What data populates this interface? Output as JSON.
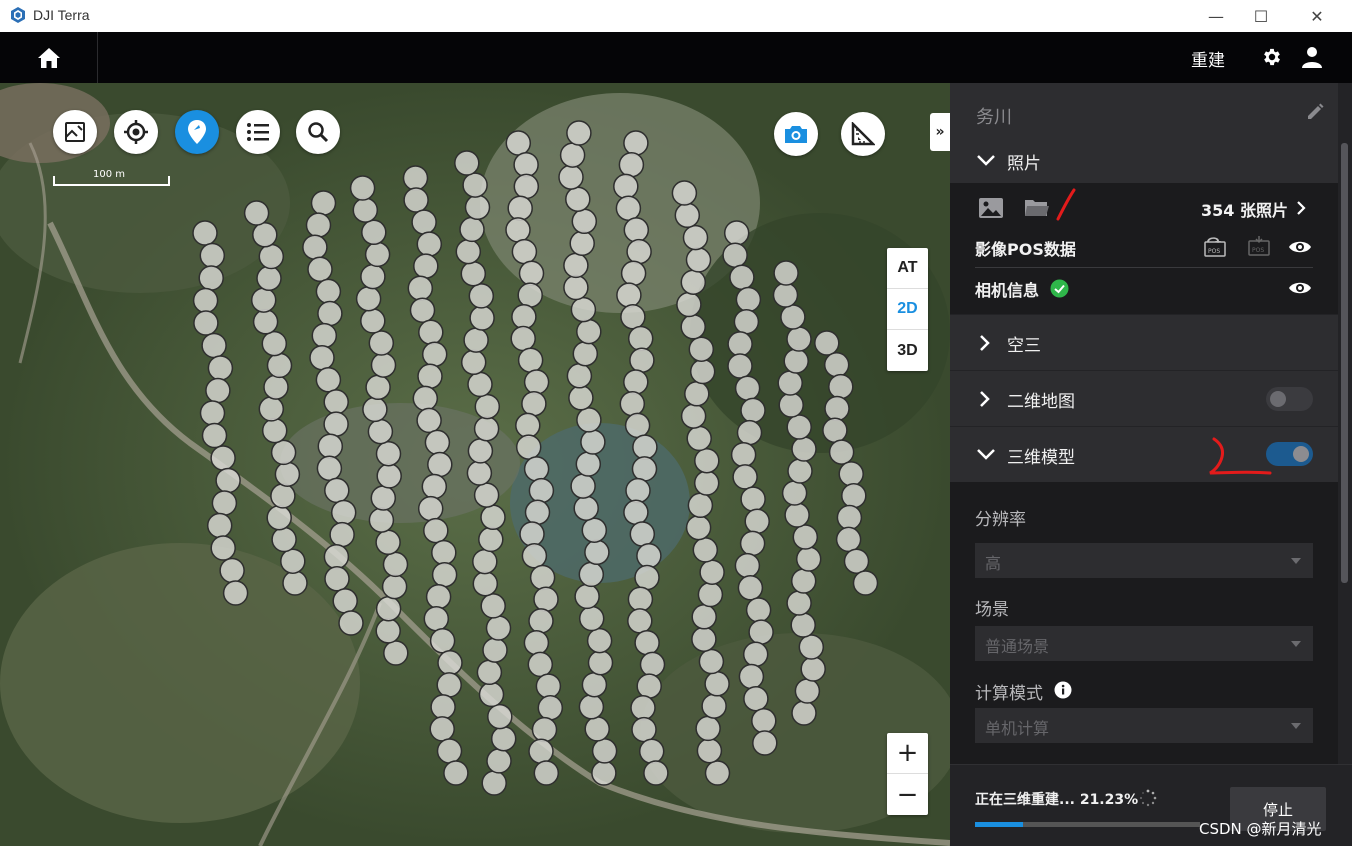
{
  "window": {
    "title": "DJI Terra",
    "minimize": "—",
    "maximize": "☐",
    "close": "✕"
  },
  "topbar": {
    "rebuild_label": "重建"
  },
  "map": {
    "scale_label": "100 m",
    "view_modes": [
      "AT",
      "2D",
      "3D"
    ],
    "selected_view_mode": "2D",
    "zoom_in": "+",
    "zoom_out": "−",
    "collapse_label": "»"
  },
  "panel": {
    "project_name": "务川",
    "photos": {
      "section_label": "照片",
      "photo_count": "354 张照片",
      "pos_label": "影像POS数据",
      "camera_label": "相机信息"
    },
    "aerotriangulation_label": "空三",
    "map2d_label": "二维地图",
    "map2d_enabled": false,
    "model3d_label": "三维模型",
    "model3d_enabled": true,
    "resolution_label": "分辨率",
    "resolution_value": "高",
    "scene_label": "场景",
    "scene_value": "普通场景",
    "compute_label": "计算模式",
    "compute_value": "单机计算",
    "progress_text": "正在三维重建... 21.23%",
    "progress_percent": 21.23,
    "stop_label": "停止"
  },
  "watermark": "CSDN @新月清光",
  "colors": {
    "accent": "#1a8fe0",
    "panel_bg": "#232326",
    "topbar_bg": "#050507",
    "annotation_red": "#e31b1b"
  }
}
